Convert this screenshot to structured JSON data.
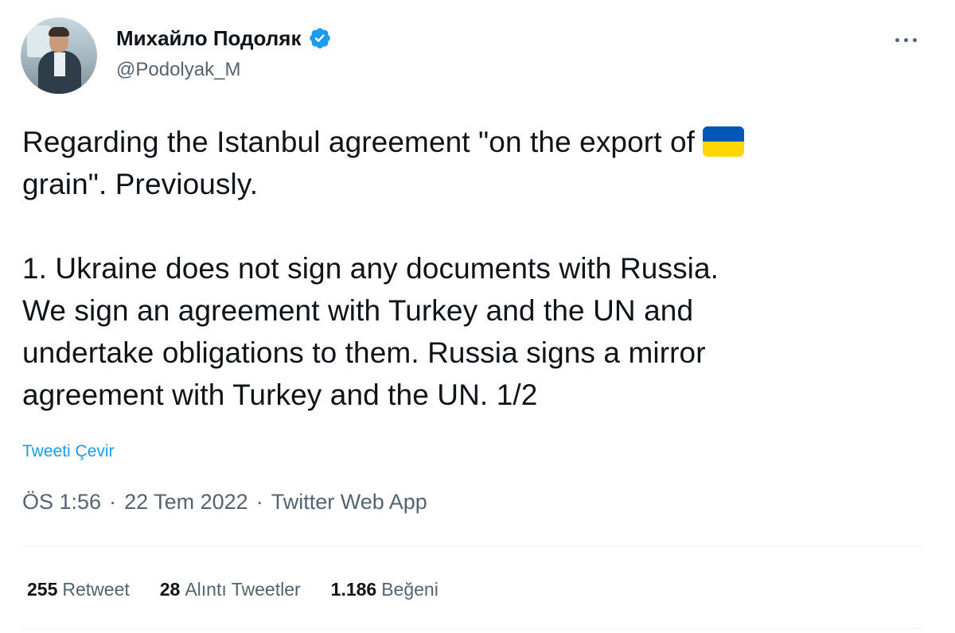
{
  "author": {
    "display_name": "Михайло Подоляк",
    "handle": "@Podolyak_M",
    "verified_icon": "verified-badge-icon"
  },
  "tweet": {
    "text_line1": "Regarding the Istanbul agreement \"on the export of",
    "text_line2": "grain\". Previously.",
    "text_body": "1. Ukraine does not sign any documents with Russia.\nWe sign an agreement with Turkey and the UN and\nundertake obligations to them. Russia signs a mirror\nagreement with Turkey and the UN. 1/2",
    "flag_icon": "ukraine-flag-icon",
    "flag_colors": [
      "#0057b7",
      "#ffd700"
    ],
    "translate_label": "Tweeti Çevir"
  },
  "meta": {
    "time": "ÖS 1:56",
    "date": "22 Tem 2022",
    "source": "Twitter Web App",
    "separator": "·"
  },
  "stats": {
    "retweets_count": "255",
    "retweets_label": "Retweet",
    "quotes_count": "28",
    "quotes_label": "Alıntı Tweetler",
    "likes_count": "1.186",
    "likes_label": "Beğeni"
  },
  "colors": {
    "accent": "#1d9bf0",
    "secondary_text": "#536471",
    "primary_text": "#0f1419",
    "divider": "#eff3f4"
  }
}
